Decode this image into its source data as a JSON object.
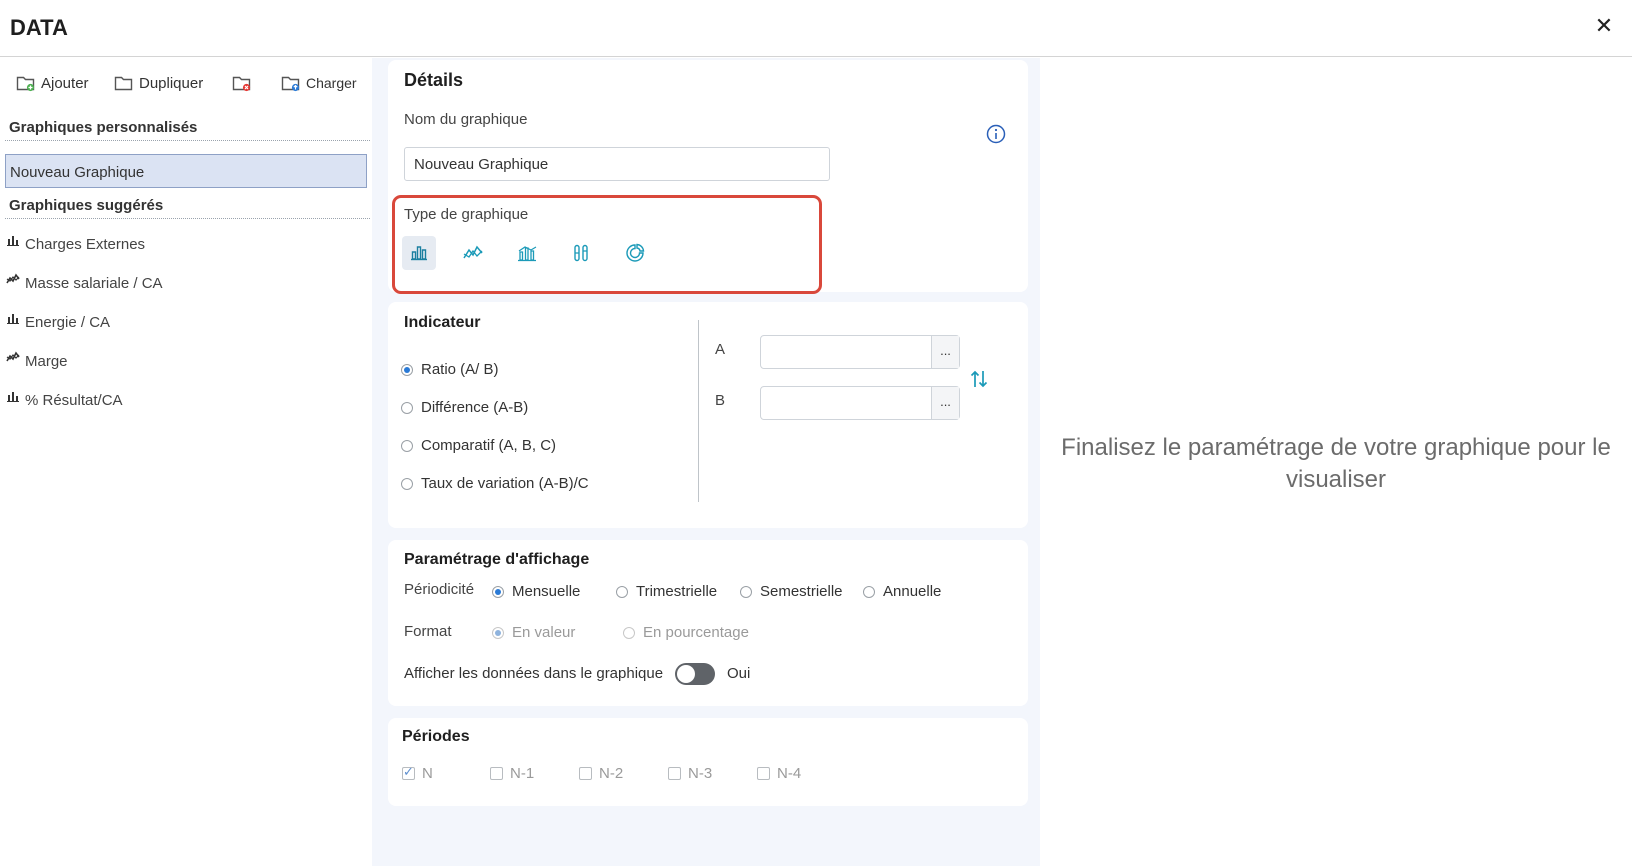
{
  "app": {
    "title": "DATA",
    "close_icon": "close-icon"
  },
  "toolbar": {
    "add_label": "Ajouter",
    "duplicate_label": "Dupliquer",
    "load_label": "Charger"
  },
  "sidebar": {
    "custom_heading": "Graphiques personnalisés",
    "custom_items": [
      {
        "label": "Nouveau Graphique"
      }
    ],
    "suggested_heading": "Graphiques suggérés",
    "suggested_items": [
      {
        "label": "Charges Externes",
        "icon": "bar-chart-icon"
      },
      {
        "label": "Masse salariale / CA",
        "icon": "line-chart-icon"
      },
      {
        "label": "Energie / CA",
        "icon": "bar-chart-icon"
      },
      {
        "label": "Marge",
        "icon": "line-chart-icon"
      },
      {
        "label": "% Résultat/CA",
        "icon": "bar-chart-icon"
      }
    ]
  },
  "details": {
    "title": "Détails",
    "name_label": "Nom du graphique",
    "name_value": "Nouveau Graphique",
    "type_label": "Type de graphique",
    "chart_types": [
      "bar-chart",
      "line-chart",
      "combo-chart",
      "column-chart",
      "donut-chart"
    ],
    "selected_type": "bar-chart"
  },
  "indicator": {
    "title": "Indicateur",
    "options": [
      {
        "label": "Ratio (A/ B)",
        "selected": true
      },
      {
        "label": "Différence (A-B)",
        "selected": false
      },
      {
        "label": "Comparatif (A, B, C)",
        "selected": false
      },
      {
        "label": "Taux de variation (A-B)/C",
        "selected": false
      }
    ],
    "field_a_label": "A",
    "field_b_label": "B",
    "picker_label": "...",
    "field_a_value": "",
    "field_b_value": ""
  },
  "display": {
    "title": "Paramétrage d'affichage",
    "periodicity_label": "Périodicité",
    "periodicity_options": [
      {
        "label": "Mensuelle",
        "selected": true
      },
      {
        "label": "Trimestrielle",
        "selected": false
      },
      {
        "label": "Semestrielle",
        "selected": false
      },
      {
        "label": "Annuelle",
        "selected": false
      }
    ],
    "format_label": "Format",
    "format_options": [
      {
        "label": "En valeur",
        "selected": true
      },
      {
        "label": "En pourcentage",
        "selected": false
      }
    ],
    "show_data_label": "Afficher les données dans le graphique",
    "show_data_state": "Oui",
    "accent_color": "#2a7ad6"
  },
  "periods": {
    "title": "Périodes",
    "items": [
      {
        "label": "N",
        "checked": true
      },
      {
        "label": "N-1",
        "checked": false
      },
      {
        "label": "N-2",
        "checked": false
      },
      {
        "label": "N-3",
        "checked": false
      },
      {
        "label": "N-4",
        "checked": false
      }
    ]
  },
  "preview": {
    "message_line1": "Finalisez le paramétrage de votre graphique pour le",
    "message_line2": "visualiser"
  },
  "colors": {
    "highlight": "#d9483b",
    "icon_teal": "#1b9ab8",
    "selected_bg": "#dbe3f3"
  }
}
